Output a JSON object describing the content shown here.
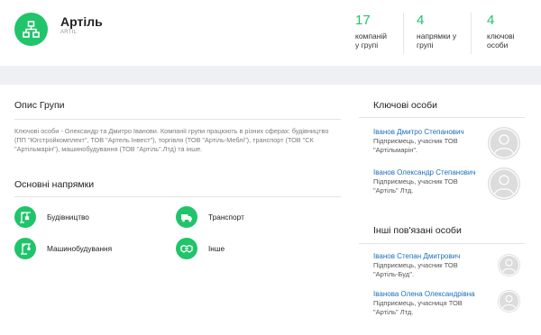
{
  "header": {
    "title": "Артіль",
    "subtitle": "ARTIL",
    "stats": [
      {
        "value": "17",
        "label_line1": "компаній",
        "label_line2": "у групі"
      },
      {
        "value": "4",
        "label_line1": "напрямки у",
        "label_line2": "групі"
      },
      {
        "value": "4",
        "label_line1": "ключові",
        "label_line2": "особи"
      }
    ]
  },
  "about": {
    "title": "Опис Групи",
    "text": "Ключові особи - Олександр та Дмитро Іванови. Компанії групи працюють в різних сферах: будівництво (ПП \"Югстройкомплект\", ТОВ \"Артель Інвест\"), торгівля (ТОВ \"Артіль-Меблі\"), транспорт (ТОВ \"СК \"Артільмарін\"), машинобудування (ТОВ \"Артіль\".Лтд) та інше."
  },
  "directions": {
    "title": "Основні напрямки",
    "items": [
      {
        "label": "Будівництво",
        "icon": "crane-icon"
      },
      {
        "label": "Транспорт",
        "icon": "truck-icon"
      },
      {
        "label": "Машинобудування",
        "icon": "machinery-icon"
      },
      {
        "label": "Інше",
        "icon": "handshake-icon"
      }
    ]
  },
  "key_persons": {
    "title": "Ключові особи",
    "items": [
      {
        "name": "Іванов Дмитро Степанович",
        "role_line1": "Підприємець, учасник ТОВ",
        "role_line2": "\"Артільмарін\"."
      },
      {
        "name": "Іванов Олександр Степанович",
        "role_line1": "Підприємець, учасник ТОВ",
        "role_line2": "\"Артіль\" Лтд."
      }
    ]
  },
  "related_persons": {
    "title": "Інші пов'язані особи",
    "items": [
      {
        "name": "Іванов Степан Дмитрович",
        "role_line1": "Підприємець, учасник ТОВ",
        "role_line2": "\"Артіль-Буд\"."
      },
      {
        "name": "Іванова Олена Олександрівна",
        "role_line1": "Підприємець, учасниця ТОВ",
        "role_line2": "\"Артіль\" Лтд."
      }
    ]
  },
  "colors": {
    "accent": "#20c46b",
    "link": "#1e6fb8",
    "background": "#eef0f3"
  }
}
